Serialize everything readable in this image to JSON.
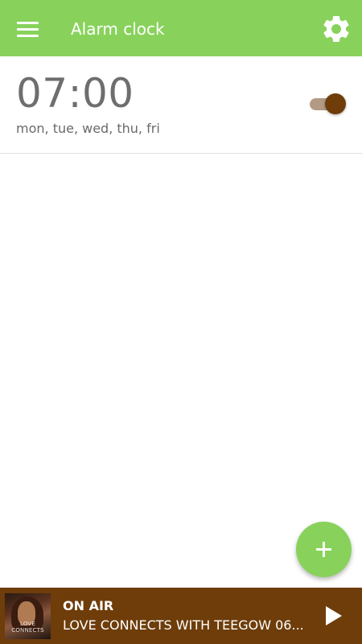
{
  "toolbar": {
    "title": "Alarm clock",
    "menu_icon": "menu-icon",
    "settings_icon": "gear-icon"
  },
  "alarms": [
    {
      "time": "07:00",
      "days": "mon, tue, wed, thu, fri",
      "enabled": true
    }
  ],
  "fab": {
    "icon": "plus-icon"
  },
  "player": {
    "status": "ON AIR",
    "track": "LOVE CONNECTS WITH TEEGOW 06...",
    "cover_text": "LOVE CONNECTS",
    "play_icon": "play-icon"
  },
  "colors": {
    "primary": "#88d25c",
    "accent": "#6e3d0a",
    "toggle_track": "#b39a84",
    "text_secondary": "#6e6e6e"
  }
}
